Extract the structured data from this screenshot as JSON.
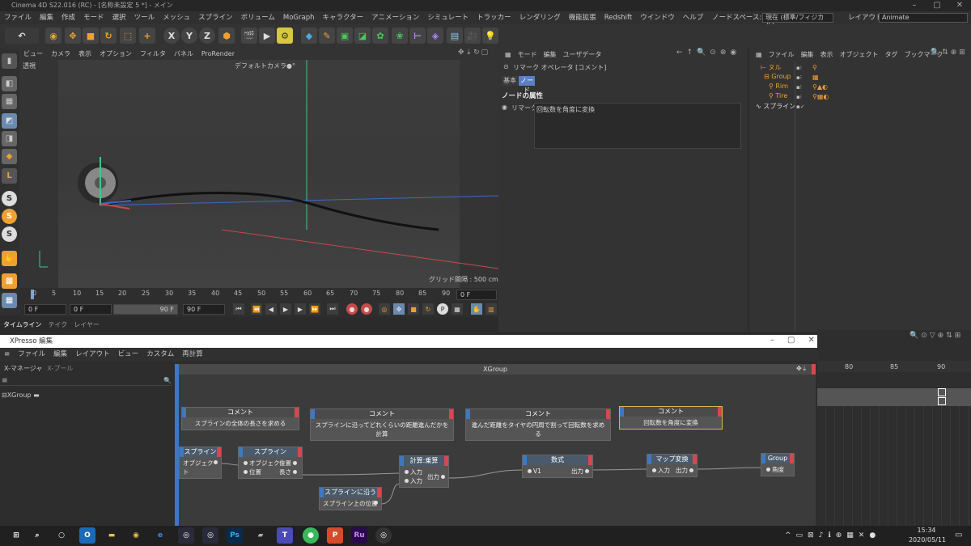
{
  "window": {
    "title": "Cinema 4D S22.016 (RC) - [名称未設定 5 *] - メイン"
  },
  "menubar": {
    "items": [
      "ファイル",
      "編集",
      "作成",
      "モード",
      "選択",
      "ツール",
      "メッシュ",
      "スプライン",
      "ボリューム",
      "MoGraph",
      "キャラクター",
      "アニメーション",
      "シミュレート",
      "トラッカー",
      "レンダリング",
      "機能拡張",
      "Redshift",
      "ウインドウ",
      "ヘルプ"
    ],
    "nodespace_label": "ノードスペース:",
    "nodespace_value": "現在 (標準/フィジカル)",
    "layout_label": "レイアウト:",
    "layout_value": "Animate"
  },
  "viewport": {
    "menu": [
      "ビュー",
      "カメラ",
      "表示",
      "オプション",
      "フィルタ",
      "パネル",
      "ProRender"
    ],
    "view_name": "透視",
    "camera": "デフォルトカメラ●°",
    "grid": "グリッド間隔 : 500 cm"
  },
  "timeline": {
    "ticks": [
      "0",
      "5",
      "10",
      "15",
      "20",
      "25",
      "30",
      "35",
      "40",
      "45",
      "50",
      "55",
      "60",
      "65",
      "70",
      "75",
      "80",
      "85",
      "90"
    ],
    "current_frame": "0 F",
    "start": "0 F",
    "preview_start": "0 F",
    "preview_end": "90 F",
    "end": "90 F"
  },
  "bottom_tabs": [
    "タイムライン",
    "テイク",
    "レイヤー"
  ],
  "attributes": {
    "menu": [
      "モード",
      "編集",
      "ユーザデータ"
    ],
    "header": "リマーク オペレータ [コメント]",
    "tabs": [
      "基本",
      "ノード"
    ],
    "section": "ノードの属性",
    "field_label": "リマーク",
    "field_value": "回転数を角度に変換"
  },
  "objects": {
    "menu": [
      "ファイル",
      "編集",
      "表示",
      "オブジェクト",
      "タグ",
      "ブックマーク"
    ],
    "items": [
      {
        "name": "ヌル",
        "indent": 0
      },
      {
        "name": "Group",
        "indent": 1
      },
      {
        "name": "Rim",
        "indent": 2
      },
      {
        "name": "Tire",
        "indent": 2
      },
      {
        "name": "スプライン",
        "indent": 0
      }
    ]
  },
  "xpresso": {
    "title": "XPresso 編集",
    "menu": [
      "ファイル",
      "編集",
      "レイアウト",
      "ビュー",
      "カスタム",
      "再計算"
    ],
    "tabs": [
      "X-マネージャ",
      "X-プール"
    ],
    "tree_item": "XGroup",
    "canvas_title": "XGroup",
    "comments": [
      {
        "title": "コメント",
        "text": "スプラインの全体の長さを求める"
      },
      {
        "title": "コメント",
        "text": "スプラインに沿ってどれくらいの距離進んだかを計算"
      },
      {
        "title": "コメント",
        "text": "進んだ距離をタイヤの円周で割って回転数を求める"
      },
      {
        "title": "コメント",
        "text": "回転数を角度に変換"
      }
    ],
    "nodes": [
      {
        "title": "スプライン",
        "ports": [
          "オブジェクト"
        ]
      },
      {
        "title": "スプライン",
        "ports_in": [
          "オブジェクト",
          "位置"
        ],
        "ports_out": [
          "位置",
          "長さ"
        ]
      },
      {
        "title": "計算:乗算",
        "ports_in": [
          "入力",
          "入力"
        ],
        "ports_out": [
          "出力"
        ]
      },
      {
        "title": "スプラインに沿う",
        "ports": [
          "スプライン上の位置"
        ]
      },
      {
        "title": "数式",
        "ports_in": [
          "V1"
        ],
        "ports_out": [
          "出力"
        ]
      },
      {
        "title": "マップ変換",
        "ports_in": [
          "入力"
        ],
        "ports_out": [
          "出力"
        ]
      },
      {
        "title": "Group",
        "ports_in": [
          "角度"
        ]
      }
    ]
  },
  "fcurve": {
    "ticks": [
      "80",
      "85",
      "90"
    ]
  },
  "taskbar": {
    "time": "15:34",
    "date": "2020/05/11"
  }
}
